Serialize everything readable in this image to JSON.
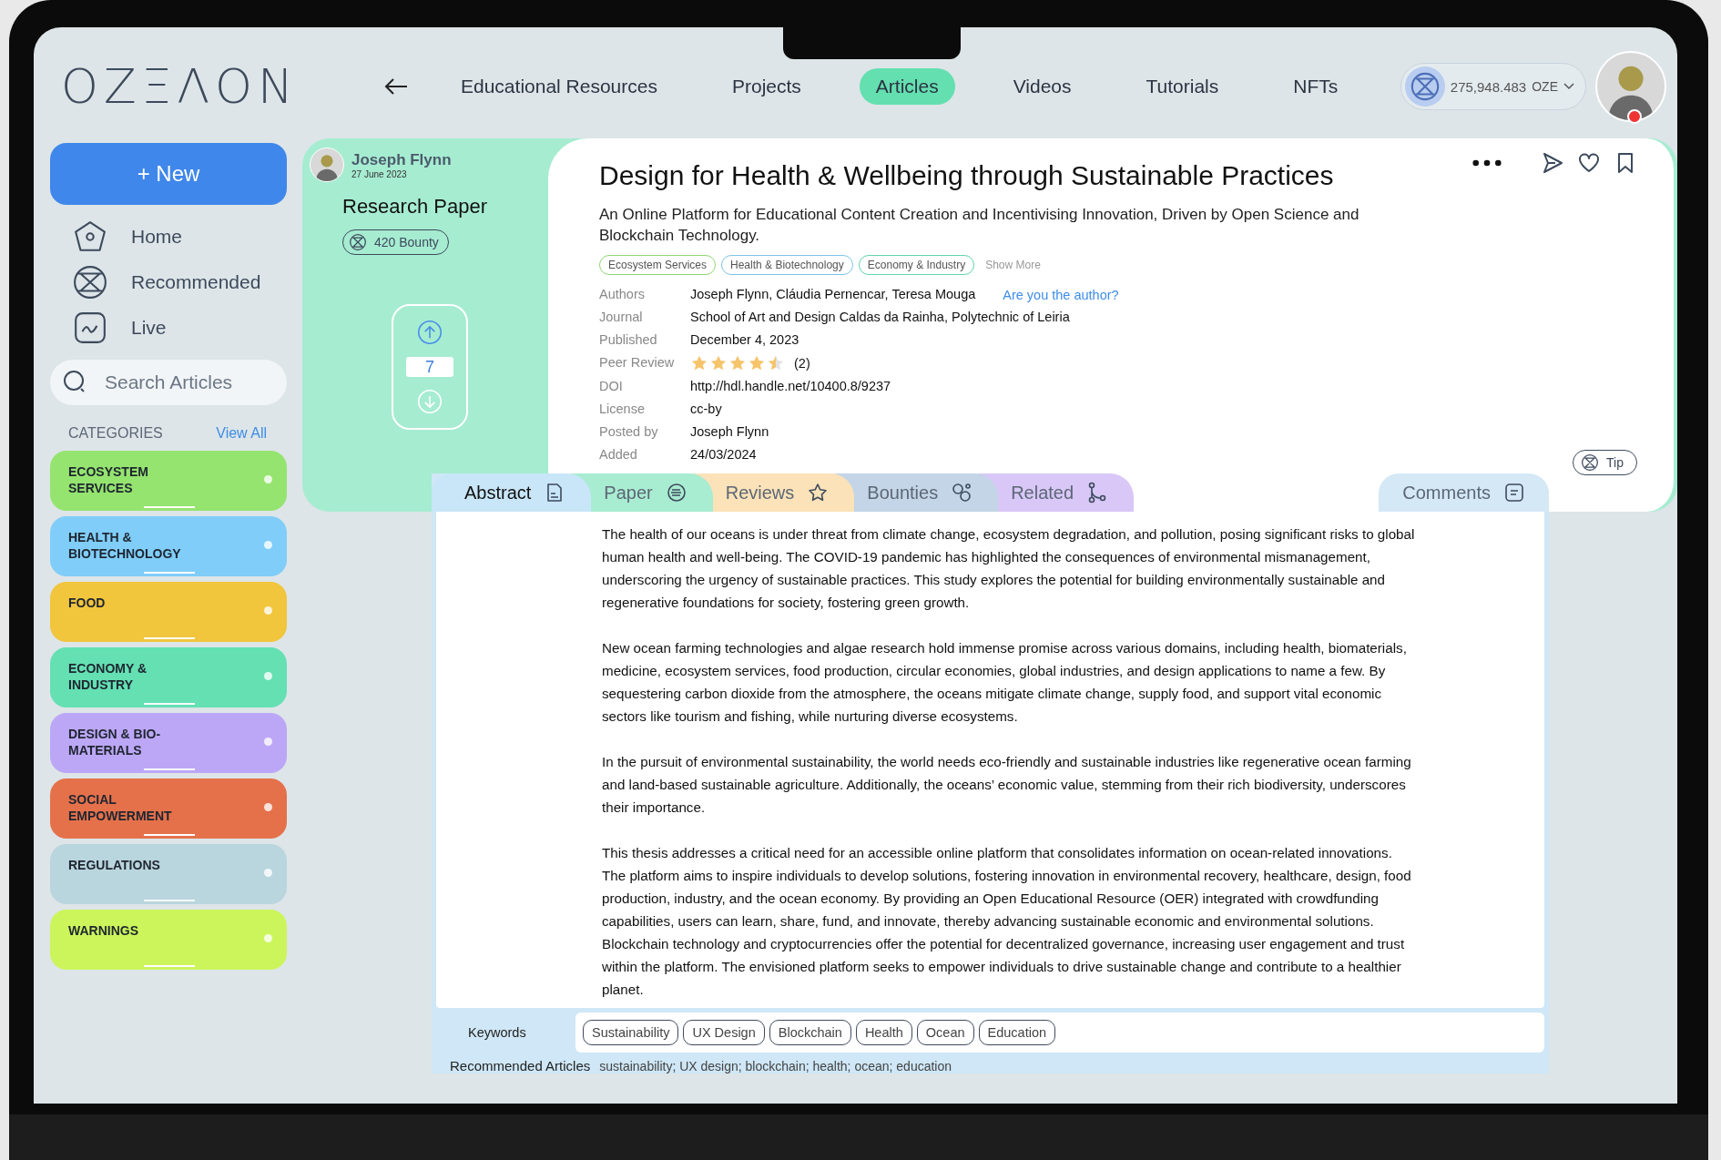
{
  "header": {
    "logo": "OZΞΛON",
    "nav": [
      {
        "label": "Educational Resources",
        "selected": false
      },
      {
        "label": "Projects",
        "selected": false
      },
      {
        "label": "Articles",
        "selected": true
      },
      {
        "label": "Videos",
        "selected": false
      },
      {
        "label": "Tutorials",
        "selected": false
      },
      {
        "label": "NFTs",
        "selected": false
      }
    ],
    "wallet": {
      "balance": "275,948.483",
      "unit": "OZE"
    },
    "avatar": {
      "has_notification": true
    }
  },
  "sidebar": {
    "new_button": "+ New",
    "items": [
      {
        "label": "Home",
        "kind": "home"
      },
      {
        "label": "Recommended",
        "kind": "recommended"
      },
      {
        "label": "Live",
        "kind": "live"
      }
    ],
    "search": {
      "placeholder": "Search Articles"
    },
    "categories_title": "CATEGORIES",
    "view_all": "View All",
    "categories": [
      {
        "label": "ECOSYSTEM SERVICES",
        "color": "#95e46f"
      },
      {
        "label": "HEALTH & BIOTECHNOLOGY",
        "color": "#80cdf9"
      },
      {
        "label": "FOOD",
        "color": "#f1c53c"
      },
      {
        "label": "ECONOMY & INDUSTRY",
        "color": "#64e0b3"
      },
      {
        "label": "DESIGN & BIO-MATERIALS",
        "color": "#bca7f6"
      },
      {
        "label": "SOCIAL EMPOWERMENT",
        "color": "#e5714b"
      },
      {
        "label": "REGULATIONS",
        "color": "#b9d5de"
      },
      {
        "label": "WARNINGS",
        "color": "#cbf55b"
      }
    ]
  },
  "article": {
    "author": "Joseph Flynn",
    "date": "27 June 2023",
    "type": "Research Paper",
    "bounty": "420 Bounty",
    "votes": "7",
    "title": "Design for Health & Wellbeing through Sustainable Practices",
    "subtitle": "An Online Platform for Educational Content Creation and Incentivising Innovation, Driven by Open Science and Blockchain Technology.",
    "tags": [
      {
        "label": "Ecosystem Services",
        "color": "#8fd86f"
      },
      {
        "label": "Health & Biotechnology",
        "color": "#7cc4e8"
      },
      {
        "label": "Economy & Industry",
        "color": "#5fd3b0"
      }
    ],
    "show_more": "Show More",
    "meta": [
      {
        "label": "Authors",
        "kind": "text",
        "value": "Joseph Flynn, Cláudia Pernencar, Teresa Mouga",
        "link": "Are you the author?"
      },
      {
        "label": "Journal",
        "kind": "text",
        "value": "School of Art and Design Caldas da Rainha, Polytechnic of Leiria"
      },
      {
        "label": "Published",
        "kind": "text",
        "value": "December 4, 2023"
      },
      {
        "label": "Peer Review",
        "kind": "rating",
        "stars": 4.5,
        "value": "(2)"
      },
      {
        "label": "DOI",
        "kind": "text",
        "value": "http://hdl.handle.net/10400.8/9237"
      },
      {
        "label": "License",
        "kind": "text",
        "value": "cc-by"
      },
      {
        "label": "Posted by",
        "kind": "text",
        "value": "Joseph Flynn"
      },
      {
        "label": "Added",
        "kind": "text",
        "value": "24/03/2024"
      }
    ],
    "tip_button": "Tip"
  },
  "tabs": [
    {
      "label": "Abstract",
      "kind": "abstract",
      "color": "#c8e6f8",
      "selected": true
    },
    {
      "label": "Paper",
      "kind": "paper",
      "color": "#a8ecd1",
      "selected": false
    },
    {
      "label": "Reviews",
      "kind": "reviews",
      "color": "#fbe2b8",
      "selected": false
    },
    {
      "label": "Bounties",
      "kind": "bounties",
      "color": "#c3d5e7",
      "selected": false
    },
    {
      "label": "Related",
      "kind": "related",
      "color": "#d8c7f7",
      "selected": false
    }
  ],
  "comments_tab": {
    "label": "Comments",
    "selected": false
  },
  "abstract": [
    "The health of our oceans is under threat from climate change, ecosystem degradation, and pollution, posing significant risks to global human health and well-being. The COVID-19 pandemic has highlighted the consequences of environmental mismanagement, underscoring the urgency of sustainable practices. This study explores the potential for building environmentally sustainable and regenerative foundations for society, fostering green growth.",
    "New ocean farming technologies and algae research hold immense promise across various domains, including health, biomaterials, medicine, ecosystem services, food production, circular economies, global industries, and design applications to name a few. By sequestering carbon dioxide from the atmosphere, the oceans mitigate climate change, supply food, and support vital economic sectors like tourism and fishing, while nurturing diverse ecosystems.",
    "In the pursuit of environmental sustainability, the world needs eco-friendly and sustainable industries like regenerative ocean farming and land-based sustainable agriculture. Additionally, the oceans’ economic value, stemming from their rich biodiversity, underscores their importance.",
    "This thesis addresses a critical need for an accessible online platform that consolidates information on ocean-related innovations. The platform aims to inspire individuals to develop solutions, fostering innovation in environmental recovery, healthcare, design, food production, industry, and the ocean economy. By providing an Open Educational Resource (OER) integrated with crowdfunding capabilities, users can learn, share, fund, and innovate, thereby advancing sustainable economic and environmental solutions. Blockchain technology and cryptocurrencies offer the potential for decentralized governance, increasing user engagement and trust within the platform. The envisioned platform seeks to empower individuals to drive sustainable change and contribute to a healthier planet."
  ],
  "keywords": {
    "label": "Keywords",
    "chips": [
      "Sustainability",
      "UX Design",
      "Blockchain",
      "Health",
      "Ocean",
      "Education"
    ],
    "text": "sustainability; UX design; blockchain; health; ocean; education"
  },
  "recommended_title": "Recommended Articles"
}
